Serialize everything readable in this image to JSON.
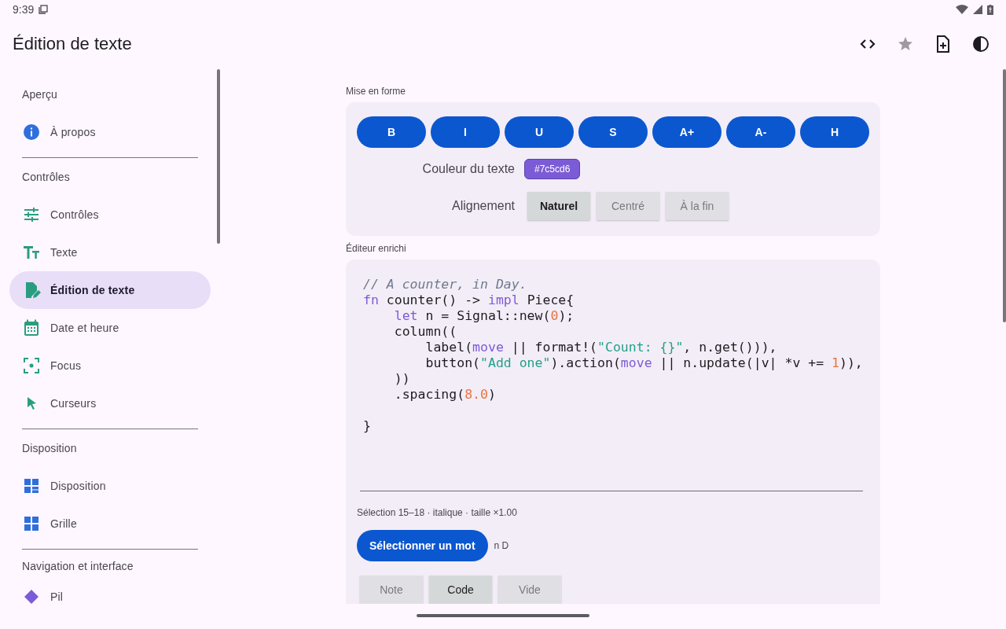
{
  "status_bar": {
    "time": "9:39"
  },
  "app_bar": {
    "title": "Édition de texte"
  },
  "sidebar": {
    "sections": [
      {
        "header": "Aperçu",
        "items": [
          {
            "label": "À propos",
            "selected": false
          }
        ]
      },
      {
        "header": "Contrôles",
        "items": [
          {
            "label": "Contrôles",
            "selected": false
          },
          {
            "label": "Texte",
            "selected": false
          },
          {
            "label": "Édition de texte",
            "selected": true
          },
          {
            "label": "Date et heure",
            "selected": false
          },
          {
            "label": "Focus",
            "selected": false
          },
          {
            "label": "Curseurs",
            "selected": false
          }
        ]
      },
      {
        "header": "Disposition",
        "items": [
          {
            "label": "Disposition",
            "selected": false
          },
          {
            "label": "Grille",
            "selected": false
          }
        ]
      },
      {
        "header": "Navigation et interface",
        "items": [
          {
            "label": "Pil",
            "selected": false
          }
        ]
      }
    ]
  },
  "formatting": {
    "title": "Mise en forme",
    "buttons": [
      "B",
      "I",
      "U",
      "S",
      "A+",
      "A-",
      "H"
    ],
    "text_color": {
      "label": "Couleur du texte",
      "value": "#7c5cd6",
      "color": "#7c5cd6"
    },
    "alignment": {
      "label": "Alignement",
      "options": [
        {
          "label": "Naturel",
          "selected": true
        },
        {
          "label": "Centré",
          "selected": false
        },
        {
          "label": "À la fin",
          "selected": false
        }
      ]
    }
  },
  "editor": {
    "title": "Éditeur enrichi",
    "lines": [
      {
        "kind": "code",
        "tokens": [
          {
            "kind": "comment",
            "text": "// A counter, in Day."
          }
        ]
      },
      {
        "kind": "code",
        "tokens": [
          {
            "kind": "keyword",
            "text": "fn"
          },
          {
            "kind": "plain",
            "text": " counter() -> "
          },
          {
            "kind": "keyword",
            "text": "impl"
          },
          {
            "kind": "plain",
            "text": " Piece{"
          }
        ]
      },
      {
        "kind": "code",
        "tokens": [
          {
            "kind": "keyword",
            "text": "    let"
          },
          {
            "kind": "plain",
            "text": " n = Signal::new("
          },
          {
            "kind": "number",
            "text": "0"
          },
          {
            "kind": "plain",
            "text": ");"
          }
        ]
      },
      {
        "kind": "code",
        "tokens": [
          {
            "kind": "plain",
            "text": "    column(("
          }
        ]
      },
      {
        "kind": "code",
        "tokens": [
          {
            "kind": "plain",
            "text": "        label("
          },
          {
            "kind": "keyword",
            "text": "move"
          },
          {
            "kind": "plain",
            "text": " || format!("
          },
          {
            "kind": "string",
            "text": "\"Count: {}\""
          },
          {
            "kind": "plain",
            "text": ", n.get())),"
          }
        ]
      },
      {
        "kind": "code",
        "tokens": [
          {
            "kind": "plain",
            "text": "        button("
          },
          {
            "kind": "string",
            "text": "\"Add one\""
          },
          {
            "kind": "plain",
            "text": ").action("
          },
          {
            "kind": "keyword",
            "text": "move"
          },
          {
            "kind": "plain",
            "text": " || n.update(|v| *v += "
          },
          {
            "kind": "number",
            "text": "1"
          },
          {
            "kind": "plain",
            "text": ")),"
          }
        ]
      },
      {
        "kind": "code",
        "tokens": [
          {
            "kind": "plain",
            "text": "    ))"
          }
        ]
      },
      {
        "kind": "code",
        "tokens": [
          {
            "kind": "plain",
            "text": "    .spacing("
          },
          {
            "kind": "number",
            "text": "8.0"
          },
          {
            "kind": "plain",
            "text": ")"
          }
        ]
      },
      {
        "kind": "blank"
      },
      {
        "kind": "code",
        "tokens": [
          {
            "kind": "plain",
            "text": "}"
          }
        ]
      }
    ],
    "selection_info": "Sélection 15–18 · italique · taille ×1.00",
    "select_word_button": "Sélectionner un mot",
    "selected_word": "n D",
    "block_types": [
      {
        "label": "Note",
        "selected": false
      },
      {
        "label": "Code",
        "selected": true
      },
      {
        "label": "Vide",
        "selected": false
      }
    ]
  }
}
